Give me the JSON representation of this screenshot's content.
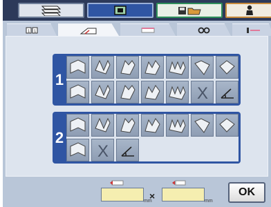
{
  "top_tabs": [
    {
      "icon": "scan-stack-icon"
    },
    {
      "icon": "screen-mode-icon"
    },
    {
      "icon": "folder-save-icon"
    },
    {
      "icon": "user-icon"
    }
  ],
  "sub_tabs": [
    {
      "icon": "duplex-page-icon"
    },
    {
      "icon": "fold-finish-icon"
    },
    {
      "icon": "staple-edge-icon"
    },
    {
      "icon": "punch-holes-icon"
    },
    {
      "icon": "offset-icon"
    }
  ],
  "groups": [
    {
      "number": "1",
      "cell_count": 14,
      "row_len": 7
    },
    {
      "number": "2",
      "cell_count": 10,
      "row_len": 7
    }
  ],
  "bottom": {
    "unit_left": "mm",
    "unit_right": "mm",
    "times": "×",
    "ok_label": "OK"
  },
  "colors": {
    "accent": "#2f55a3",
    "input_fill": "#f5eeb0"
  }
}
